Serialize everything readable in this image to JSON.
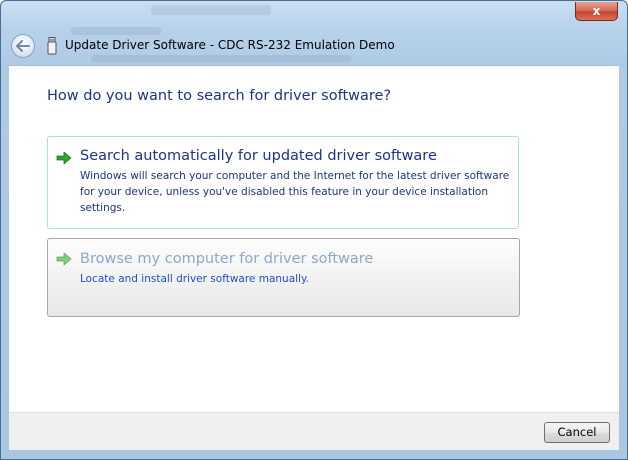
{
  "window": {
    "title": "Update Driver Software - CDC RS-232 Emulation Demo",
    "close_label": "x"
  },
  "content": {
    "heading": "How do you want to search for driver software?",
    "options": [
      {
        "title": "Search automatically for updated driver software",
        "description": "Windows will search your computer and the Internet for the latest driver software for your device, unless you've disabled this feature in your device installation settings."
      },
      {
        "title": "Browse my computer for driver software",
        "description": "Locate and install driver software manually."
      }
    ]
  },
  "footer": {
    "cancel_label": "Cancel"
  },
  "icons": {
    "back": "back-arrow-icon",
    "device": "usb-device-icon",
    "option_arrow": "green-arrow-icon"
  },
  "colors": {
    "heading": "#1e3287",
    "link_blue": "#1f4fc4",
    "option_arrow": "#2ea52e",
    "close_red": "#c7432b"
  }
}
